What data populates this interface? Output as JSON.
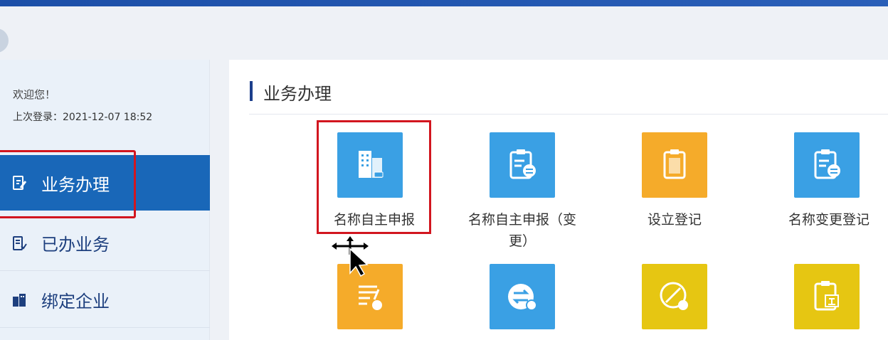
{
  "sidebar": {
    "welcome": "欢迎您！",
    "last_login": "上次登录：2021-12-07 18:52",
    "items": [
      {
        "label": "业务办理",
        "icon": "edit-doc-icon"
      },
      {
        "label": "已办业务",
        "icon": "done-doc-icon"
      },
      {
        "label": "绑定企业",
        "icon": "building-icon"
      }
    ]
  },
  "main": {
    "section_title": "业务办理",
    "tiles": [
      {
        "label": "名称自主申报",
        "icon": "building-icon",
        "color": "#3aa0e4"
      },
      {
        "label": "名称自主申报（变更）",
        "icon": "clipboard-list-icon",
        "color": "#3aa0e4"
      },
      {
        "label": "设立登记",
        "icon": "clipboard-icon",
        "color": "#f5ab2a"
      },
      {
        "label": "名称变更登记",
        "icon": "clipboard-list-icon",
        "color": "#3aa0e4"
      },
      {
        "label": "",
        "icon": "edit-list-icon",
        "color": "#f5ab2a"
      },
      {
        "label": "",
        "icon": "transfer-icon",
        "color": "#3aa0e4"
      },
      {
        "label": "",
        "icon": "cancel-icon",
        "color": "#e6c612"
      },
      {
        "label": "",
        "icon": "clipboard-main-icon",
        "color": "#e6c612"
      }
    ]
  },
  "colors": {
    "accent": "#1967b8",
    "highlight": "#d2161f"
  }
}
